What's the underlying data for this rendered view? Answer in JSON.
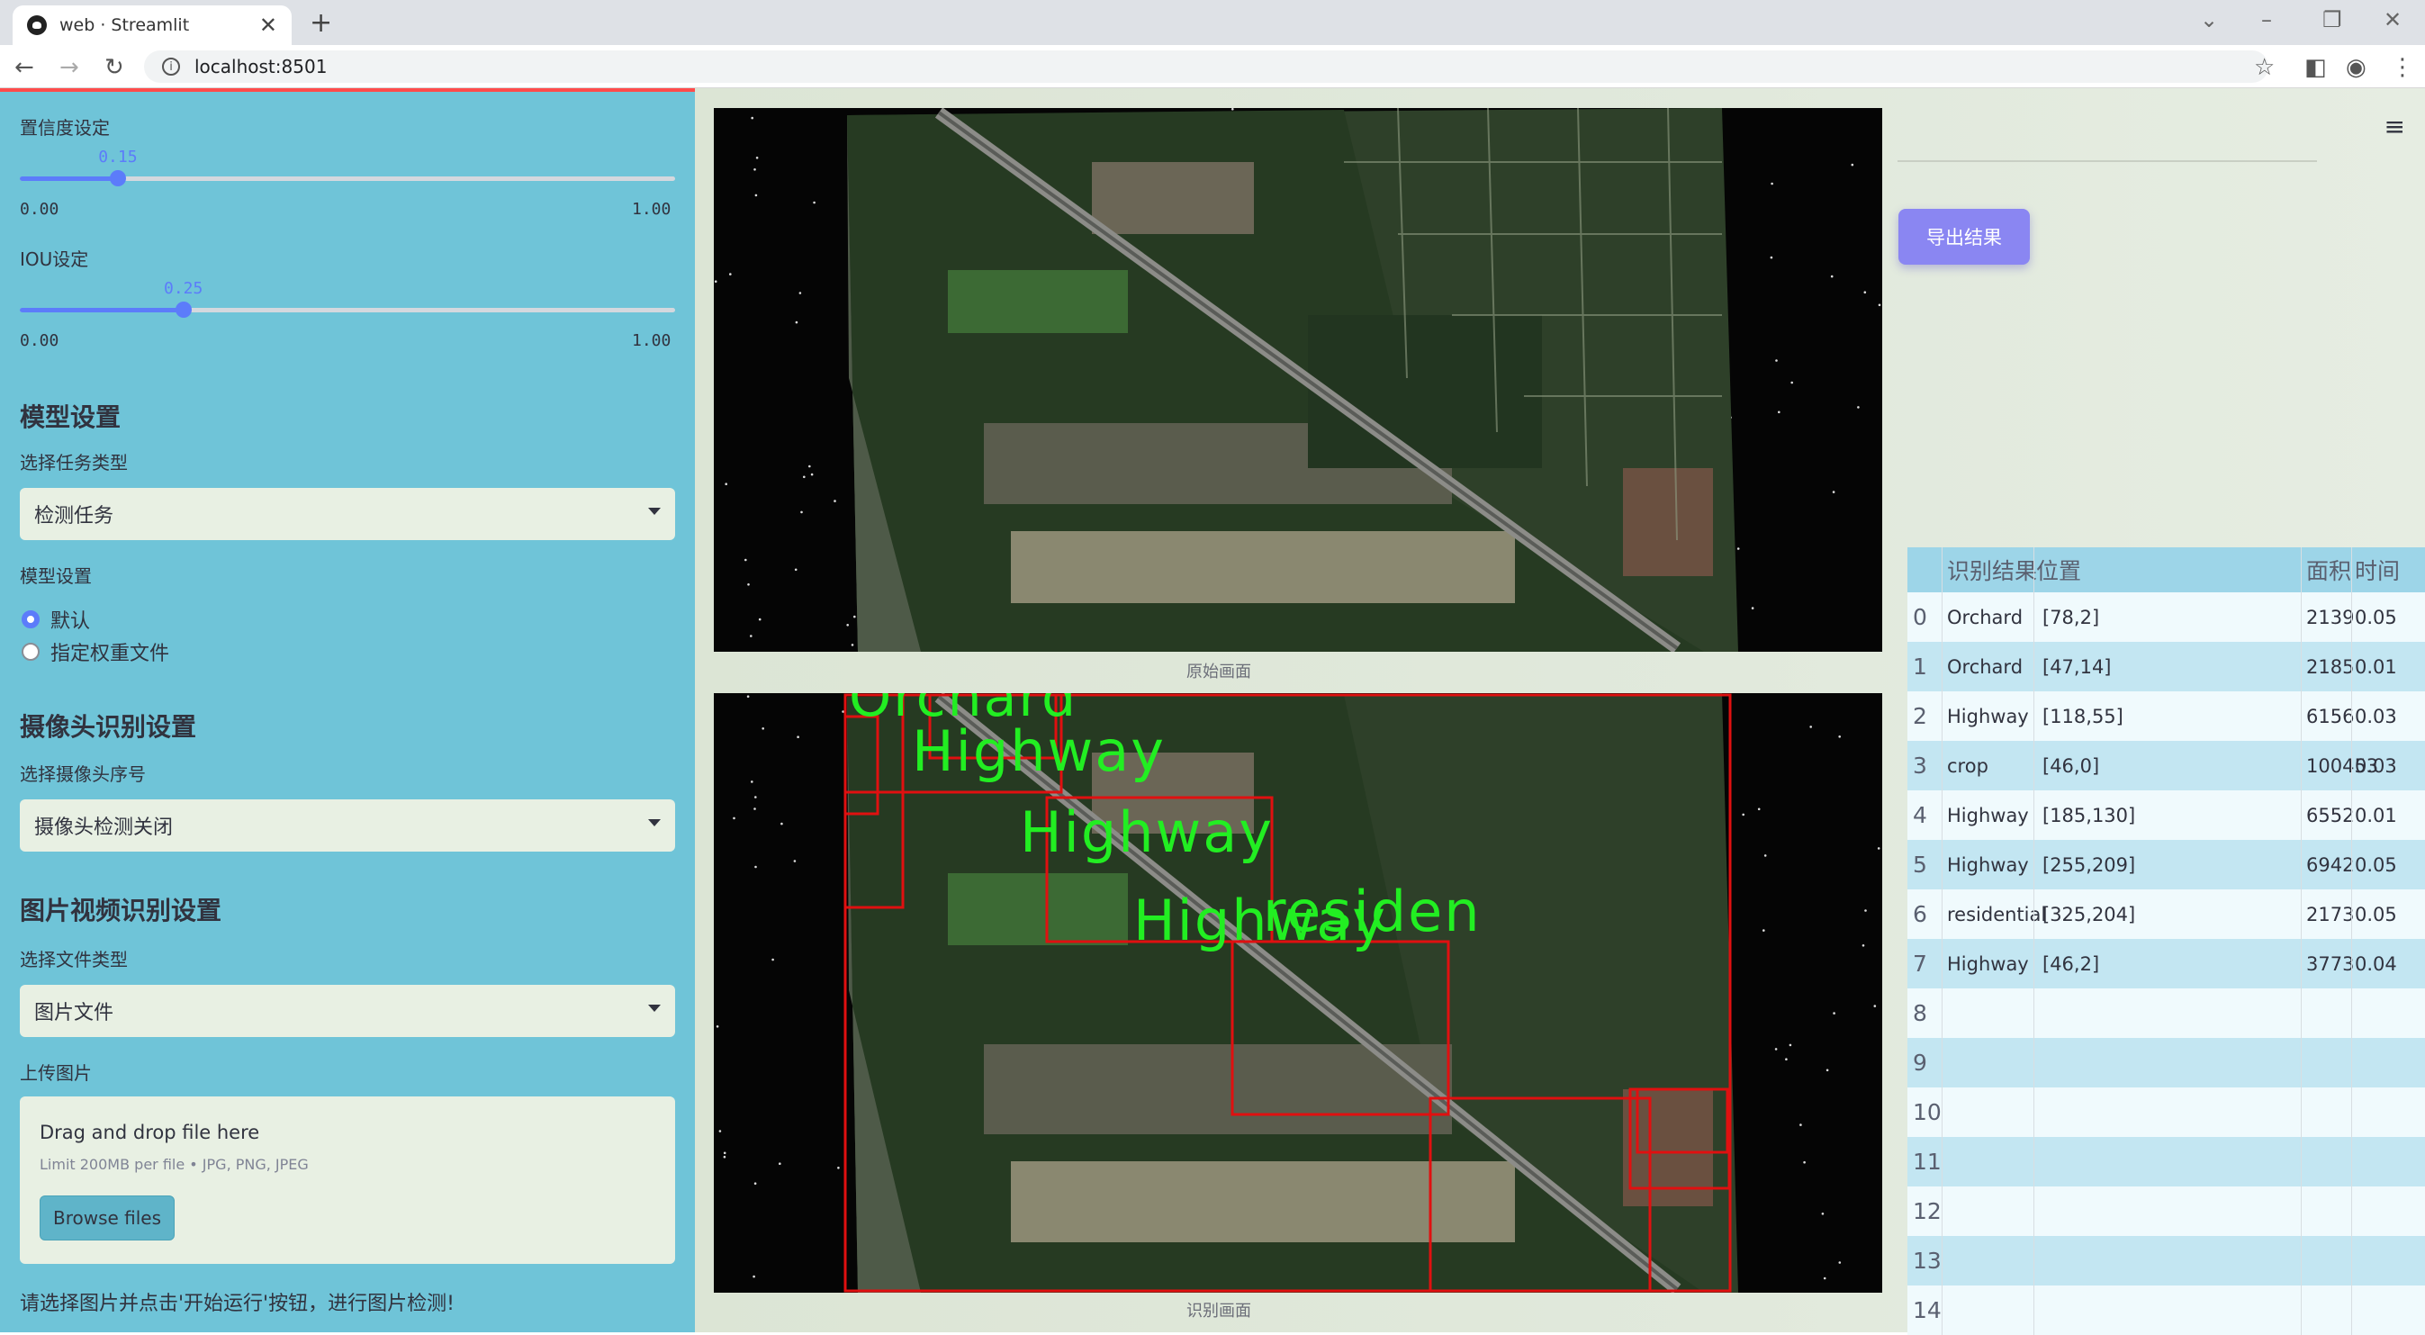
{
  "browser": {
    "tab_title": "web · Streamlit",
    "close_glyph": "✕",
    "newtab_glyph": "+",
    "url": "localhost:8501",
    "icons": [
      "back-icon",
      "forward-icon",
      "reload-icon",
      "info-icon",
      "star-icon",
      "sidepanel-icon",
      "profile-icon",
      "more-icon"
    ]
  },
  "sidebar": {
    "conf_label": "置信度设定",
    "conf_value": "0.15",
    "conf_fraction": 0.15,
    "conf_min": "0.00",
    "conf_max": "1.00",
    "iou_label": "IOU设定",
    "iou_value": "0.25",
    "iou_fraction": 0.25,
    "iou_min": "0.00",
    "iou_max": "1.00",
    "model_section": "模型设置",
    "task_label": "选择任务类型",
    "task_value": "检测任务",
    "model_label": "模型设置",
    "radio_default": "默认",
    "radio_custom": "指定权重文件",
    "camera_section": "摄像头识别设置",
    "camera_label": "选择摄像头序号",
    "camera_value": "摄像头检测关闭",
    "media_section": "图片视频识别设置",
    "filetype_label": "选择文件类型",
    "filetype_value": "图片文件",
    "upload_label": "上传图片",
    "upload_drag": "Drag and drop file here",
    "upload_limit": "Limit 200MB per file • JPG, PNG, JPEG",
    "browse_button": "Browse files",
    "bottom_message": "请选择图片并点击'开始运行'按钮，进行图片检测!"
  },
  "main": {
    "original_caption": "原始画面",
    "detect_caption": "识别画面",
    "export_button": "导出结果",
    "overlay_labels": [
      "Orchard",
      "Highway",
      "Highway",
      "Highway",
      "residen"
    ],
    "table": {
      "headers": [
        "识别结果",
        "位置",
        "面积",
        "时间"
      ],
      "rows": [
        {
          "idx": "0",
          "name": "Orchard",
          "pos": "[78,2]",
          "area": "2139",
          "time": "0.05"
        },
        {
          "idx": "1",
          "name": "Orchard",
          "pos": "[47,14]",
          "area": "2185",
          "time": "0.01"
        },
        {
          "idx": "2",
          "name": "Highway",
          "pos": "[118,55]",
          "area": "6156",
          "time": "0.03"
        },
        {
          "idx": "3",
          "name": "crop",
          "pos": "[46,0]",
          "area": "100453",
          "time": "0.03"
        },
        {
          "idx": "4",
          "name": "Highway",
          "pos": "[185,130]",
          "area": "6552",
          "time": "0.01"
        },
        {
          "idx": "5",
          "name": "Highway",
          "pos": "[255,209]",
          "area": "6942",
          "time": "0.05"
        },
        {
          "idx": "6",
          "name": "residential",
          "pos": "[325,204]",
          "area": "2173",
          "time": "0.05"
        },
        {
          "idx": "7",
          "name": "Highway",
          "pos": "[46,2]",
          "area": "3773",
          "time": "0.04"
        },
        {
          "idx": "8",
          "name": "",
          "pos": "",
          "area": "",
          "time": ""
        },
        {
          "idx": "9",
          "name": "",
          "pos": "",
          "area": "",
          "time": ""
        },
        {
          "idx": "10",
          "name": "",
          "pos": "",
          "area": "",
          "time": ""
        },
        {
          "idx": "11",
          "name": "",
          "pos": "",
          "area": "",
          "time": ""
        },
        {
          "idx": "12",
          "name": "",
          "pos": "",
          "area": "",
          "time": ""
        },
        {
          "idx": "13",
          "name": "",
          "pos": "",
          "area": "",
          "time": ""
        },
        {
          "idx": "14",
          "name": "",
          "pos": "",
          "area": "",
          "time": ""
        }
      ]
    }
  },
  "colors": {
    "sidebar_bg": "#6fc4d8",
    "accent": "#5c7cfa",
    "export_bg": "#8a86f2",
    "box_red": "#e01010",
    "label_green": "#22ee22"
  }
}
